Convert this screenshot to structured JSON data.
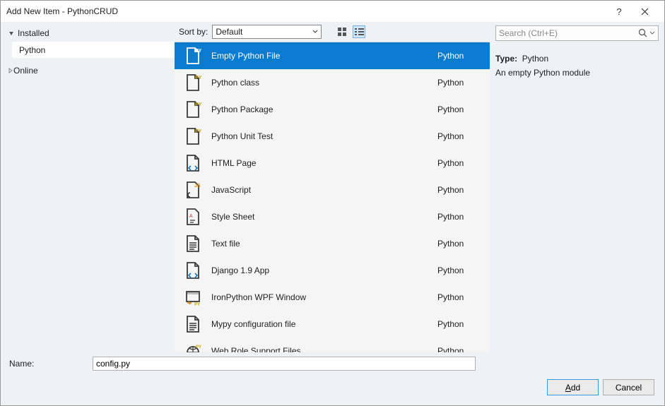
{
  "window": {
    "title": "Add New Item - PythonCRUD"
  },
  "sidebar": {
    "installed_label": "Installed",
    "python_label": "Python",
    "online_label": "Online"
  },
  "toolbar": {
    "sort_label": "Sort by:",
    "sort_value": "Default"
  },
  "search": {
    "placeholder": "Search (Ctrl+E)"
  },
  "templates": [
    {
      "name": "Empty Python File",
      "lang": "Python",
      "icon": "pyfile",
      "selected": true
    },
    {
      "name": "Python class",
      "lang": "Python",
      "icon": "pyfile"
    },
    {
      "name": "Python Package",
      "lang": "Python",
      "icon": "pyfile"
    },
    {
      "name": "Python Unit Test",
      "lang": "Python",
      "icon": "pyfile"
    },
    {
      "name": "HTML Page",
      "lang": "Python",
      "icon": "html"
    },
    {
      "name": "JavaScript",
      "lang": "Python",
      "icon": "js"
    },
    {
      "name": "Style Sheet",
      "lang": "Python",
      "icon": "css"
    },
    {
      "name": "Text file",
      "lang": "Python",
      "icon": "text"
    },
    {
      "name": "Django 1.9 App",
      "lang": "Python",
      "icon": "html"
    },
    {
      "name": "IronPython WPF Window",
      "lang": "Python",
      "icon": "wpf"
    },
    {
      "name": "Mypy configuration file",
      "lang": "Python",
      "icon": "text"
    },
    {
      "name": "Web Role Support Files",
      "lang": "Python",
      "icon": "web"
    }
  ],
  "details": {
    "type_label": "Type:",
    "type_value": "Python",
    "description": "An empty Python module"
  },
  "footer": {
    "name_label": "Name:",
    "name_value": "config.py",
    "add_label": "Add",
    "cancel_label": "Cancel"
  }
}
